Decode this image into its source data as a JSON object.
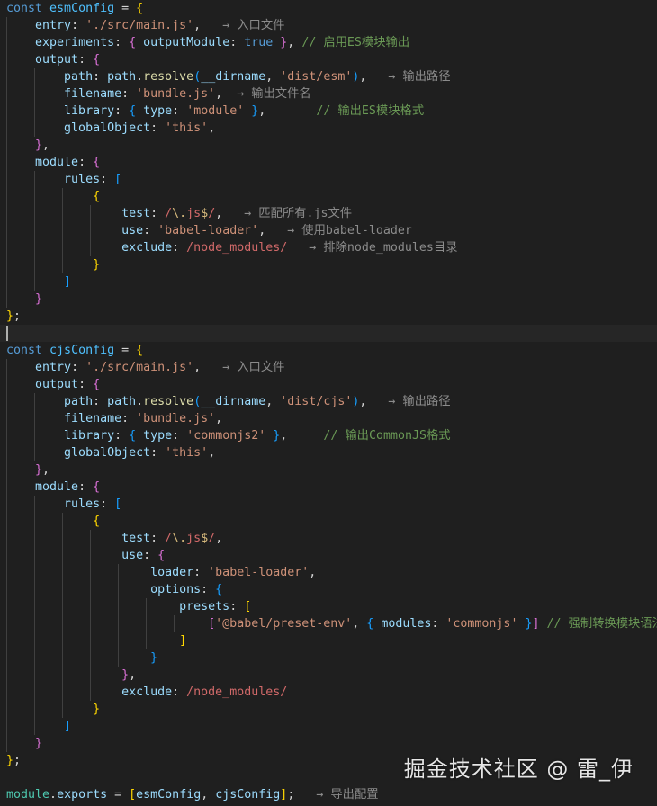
{
  "editor": {
    "language": "javascript",
    "theme_background": "#1f1f1f",
    "watermark": "掘金技术社区 @ 雷_伊",
    "lines": [
      [
        {
          "t": "const ",
          "c": "kw"
        },
        {
          "t": "esmConfig",
          "c": "var"
        },
        {
          "t": " = ",
          "c": "op"
        },
        {
          "t": "{",
          "c": "p1"
        }
      ],
      [
        {
          "t": "    "
        },
        {
          "t": "entry",
          "c": "prop"
        },
        {
          "t": ": "
        },
        {
          "t": "'./src/main.js'",
          "c": "str"
        },
        {
          "t": ",  "
        },
        {
          "t": " → 入口文件",
          "c": "arrow"
        }
      ],
      [
        {
          "t": "    "
        },
        {
          "t": "experiments",
          "c": "prop"
        },
        {
          "t": ": "
        },
        {
          "t": "{",
          "c": "p2"
        },
        {
          "t": " "
        },
        {
          "t": "outputModule",
          "c": "prop"
        },
        {
          "t": ": "
        },
        {
          "t": "true",
          "c": "kw"
        },
        {
          "t": " "
        },
        {
          "t": "}",
          "c": "p2"
        },
        {
          "t": ", "
        },
        {
          "t": "// 启用ES模块输出",
          "c": "cm"
        }
      ],
      [
        {
          "t": "    "
        },
        {
          "t": "output",
          "c": "prop"
        },
        {
          "t": ": "
        },
        {
          "t": "{",
          "c": "p2"
        }
      ],
      [
        {
          "t": "        "
        },
        {
          "t": "path",
          "c": "prop"
        },
        {
          "t": ": "
        },
        {
          "t": "path",
          "c": "prop"
        },
        {
          "t": "."
        },
        {
          "t": "resolve",
          "c": "fn"
        },
        {
          "t": "(",
          "c": "p3"
        },
        {
          "t": "__dirname",
          "c": "prop"
        },
        {
          "t": ", "
        },
        {
          "t": "'dist/esm'",
          "c": "str"
        },
        {
          "t": ")",
          "c": "p3"
        },
        {
          "t": ",  "
        },
        {
          "t": " → 输出路径",
          "c": "arrow"
        }
      ],
      [
        {
          "t": "        "
        },
        {
          "t": "filename",
          "c": "prop"
        },
        {
          "t": ": "
        },
        {
          "t": "'bundle.js'",
          "c": "str"
        },
        {
          "t": ", "
        },
        {
          "t": " → 输出文件名",
          "c": "arrow"
        }
      ],
      [
        {
          "t": "        "
        },
        {
          "t": "library",
          "c": "prop"
        },
        {
          "t": ": "
        },
        {
          "t": "{",
          "c": "p3"
        },
        {
          "t": " "
        },
        {
          "t": "type",
          "c": "prop"
        },
        {
          "t": ": "
        },
        {
          "t": "'module'",
          "c": "str"
        },
        {
          "t": " "
        },
        {
          "t": "}",
          "c": "p3"
        },
        {
          "t": ",       "
        },
        {
          "t": "// 输出ES模块格式",
          "c": "cm"
        }
      ],
      [
        {
          "t": "        "
        },
        {
          "t": "globalObject",
          "c": "prop"
        },
        {
          "t": ": "
        },
        {
          "t": "'this'",
          "c": "str"
        },
        {
          "t": ","
        }
      ],
      [
        {
          "t": "    "
        },
        {
          "t": "}",
          "c": "p2"
        },
        {
          "t": ","
        }
      ],
      [
        {
          "t": "    "
        },
        {
          "t": "module",
          "c": "prop"
        },
        {
          "t": ": "
        },
        {
          "t": "{",
          "c": "p2"
        }
      ],
      [
        {
          "t": "        "
        },
        {
          "t": "rules",
          "c": "prop"
        },
        {
          "t": ": "
        },
        {
          "t": "[",
          "c": "p3"
        }
      ],
      [
        {
          "t": "            "
        },
        {
          "t": "{",
          "c": "p1"
        }
      ],
      [
        {
          "t": "                "
        },
        {
          "t": "test",
          "c": "prop"
        },
        {
          "t": ": "
        },
        {
          "t": "/",
          "c": "re"
        },
        {
          "t": "\\.",
          "c": "rx"
        },
        {
          "t": "js",
          "c": "re"
        },
        {
          "t": "$",
          "c": "rx"
        },
        {
          "t": "/",
          "c": "re"
        },
        {
          "t": ",  "
        },
        {
          "t": " → 匹配所有.js文件",
          "c": "arrow"
        }
      ],
      [
        {
          "t": "                "
        },
        {
          "t": "use",
          "c": "prop"
        },
        {
          "t": ": "
        },
        {
          "t": "'babel-loader'",
          "c": "str"
        },
        {
          "t": ",  "
        },
        {
          "t": " → 使用babel-loader",
          "c": "arrow"
        }
      ],
      [
        {
          "t": "                "
        },
        {
          "t": "exclude",
          "c": "prop"
        },
        {
          "t": ": "
        },
        {
          "t": "/node_modules/",
          "c": "re"
        },
        {
          "t": "  "
        },
        {
          "t": " → 排除node_modules目录",
          "c": "arrow"
        }
      ],
      [
        {
          "t": "            "
        },
        {
          "t": "}",
          "c": "p1"
        }
      ],
      [
        {
          "t": "        "
        },
        {
          "t": "]",
          "c": "p3"
        }
      ],
      [
        {
          "t": "    "
        },
        {
          "t": "}",
          "c": "p2"
        }
      ],
      [
        {
          "t": "}",
          "c": "p1"
        },
        {
          "t": ";"
        }
      ],
      [
        {
          "t": ""
        }
      ],
      [
        {
          "t": "const ",
          "c": "kw"
        },
        {
          "t": "cjsConfig",
          "c": "var"
        },
        {
          "t": " = ",
          "c": "op"
        },
        {
          "t": "{",
          "c": "p1"
        }
      ],
      [
        {
          "t": "    "
        },
        {
          "t": "entry",
          "c": "prop"
        },
        {
          "t": ": "
        },
        {
          "t": "'./src/main.js'",
          "c": "str"
        },
        {
          "t": ",  "
        },
        {
          "t": " → 入口文件",
          "c": "arrow"
        }
      ],
      [
        {
          "t": "    "
        },
        {
          "t": "output",
          "c": "prop"
        },
        {
          "t": ": "
        },
        {
          "t": "{",
          "c": "p2"
        }
      ],
      [
        {
          "t": "        "
        },
        {
          "t": "path",
          "c": "prop"
        },
        {
          "t": ": "
        },
        {
          "t": "path",
          "c": "prop"
        },
        {
          "t": "."
        },
        {
          "t": "resolve",
          "c": "fn"
        },
        {
          "t": "(",
          "c": "p3"
        },
        {
          "t": "__dirname",
          "c": "prop"
        },
        {
          "t": ", "
        },
        {
          "t": "'dist/cjs'",
          "c": "str"
        },
        {
          "t": ")",
          "c": "p3"
        },
        {
          "t": ",  "
        },
        {
          "t": " → 输出路径",
          "c": "arrow"
        }
      ],
      [
        {
          "t": "        "
        },
        {
          "t": "filename",
          "c": "prop"
        },
        {
          "t": ": "
        },
        {
          "t": "'bundle.js'",
          "c": "str"
        },
        {
          "t": ","
        }
      ],
      [
        {
          "t": "        "
        },
        {
          "t": "library",
          "c": "prop"
        },
        {
          "t": ": "
        },
        {
          "t": "{",
          "c": "p3"
        },
        {
          "t": " "
        },
        {
          "t": "type",
          "c": "prop"
        },
        {
          "t": ": "
        },
        {
          "t": "'commonjs2'",
          "c": "str"
        },
        {
          "t": " "
        },
        {
          "t": "}",
          "c": "p3"
        },
        {
          "t": ",     "
        },
        {
          "t": "// 输出CommonJS格式",
          "c": "cm"
        }
      ],
      [
        {
          "t": "        "
        },
        {
          "t": "globalObject",
          "c": "prop"
        },
        {
          "t": ": "
        },
        {
          "t": "'this'",
          "c": "str"
        },
        {
          "t": ","
        }
      ],
      [
        {
          "t": "    "
        },
        {
          "t": "}",
          "c": "p2"
        },
        {
          "t": ","
        }
      ],
      [
        {
          "t": "    "
        },
        {
          "t": "module",
          "c": "prop"
        },
        {
          "t": ": "
        },
        {
          "t": "{",
          "c": "p2"
        }
      ],
      [
        {
          "t": "        "
        },
        {
          "t": "rules",
          "c": "prop"
        },
        {
          "t": ": "
        },
        {
          "t": "[",
          "c": "p3"
        }
      ],
      [
        {
          "t": "            "
        },
        {
          "t": "{",
          "c": "p1"
        }
      ],
      [
        {
          "t": "                "
        },
        {
          "t": "test",
          "c": "prop"
        },
        {
          "t": ": "
        },
        {
          "t": "/",
          "c": "re"
        },
        {
          "t": "\\.",
          "c": "rx"
        },
        {
          "t": "js",
          "c": "re"
        },
        {
          "t": "$",
          "c": "rx"
        },
        {
          "t": "/",
          "c": "re"
        },
        {
          "t": ","
        }
      ],
      [
        {
          "t": "                "
        },
        {
          "t": "use",
          "c": "prop"
        },
        {
          "t": ": "
        },
        {
          "t": "{",
          "c": "p2"
        }
      ],
      [
        {
          "t": "                    "
        },
        {
          "t": "loader",
          "c": "prop"
        },
        {
          "t": ": "
        },
        {
          "t": "'babel-loader'",
          "c": "str"
        },
        {
          "t": ","
        }
      ],
      [
        {
          "t": "                    "
        },
        {
          "t": "options",
          "c": "prop"
        },
        {
          "t": ": "
        },
        {
          "t": "{",
          "c": "p3"
        }
      ],
      [
        {
          "t": "                        "
        },
        {
          "t": "presets",
          "c": "prop"
        },
        {
          "t": ": "
        },
        {
          "t": "[",
          "c": "p1"
        }
      ],
      [
        {
          "t": "                            "
        },
        {
          "t": "[",
          "c": "p2"
        },
        {
          "t": "'@babel/preset-env'",
          "c": "str"
        },
        {
          "t": ", "
        },
        {
          "t": "{",
          "c": "p3"
        },
        {
          "t": " "
        },
        {
          "t": "modules",
          "c": "prop"
        },
        {
          "t": ": "
        },
        {
          "t": "'commonjs'",
          "c": "str"
        },
        {
          "t": " "
        },
        {
          "t": "}",
          "c": "p3"
        },
        {
          "t": "]",
          "c": "p2"
        },
        {
          "t": " "
        },
        {
          "t": "// 强制转换模块语法",
          "c": "cm"
        }
      ],
      [
        {
          "t": "                        "
        },
        {
          "t": "]",
          "c": "p1"
        }
      ],
      [
        {
          "t": "                    "
        },
        {
          "t": "}",
          "c": "p3"
        }
      ],
      [
        {
          "t": "                "
        },
        {
          "t": "}",
          "c": "p2"
        },
        {
          "t": ","
        }
      ],
      [
        {
          "t": "                "
        },
        {
          "t": "exclude",
          "c": "prop"
        },
        {
          "t": ": "
        },
        {
          "t": "/node_modules/",
          "c": "re"
        }
      ],
      [
        {
          "t": "            "
        },
        {
          "t": "}",
          "c": "p1"
        }
      ],
      [
        {
          "t": "        "
        },
        {
          "t": "]",
          "c": "p3"
        }
      ],
      [
        {
          "t": "    "
        },
        {
          "t": "}",
          "c": "p2"
        }
      ],
      [
        {
          "t": "}",
          "c": "p1"
        },
        {
          "t": ";"
        }
      ],
      [
        {
          "t": ""
        }
      ],
      [
        {
          "t": "module",
          "c": "obj"
        },
        {
          "t": "."
        },
        {
          "t": "exports",
          "c": "prop"
        },
        {
          "t": " = "
        },
        {
          "t": "[",
          "c": "p1"
        },
        {
          "t": "esmConfig",
          "c": "prop"
        },
        {
          "t": ", "
        },
        {
          "t": "cjsConfig",
          "c": "prop"
        },
        {
          "t": "]",
          "c": "p1"
        },
        {
          "t": ";  "
        },
        {
          "t": " → 导出配置",
          "c": "arrow"
        }
      ]
    ]
  }
}
